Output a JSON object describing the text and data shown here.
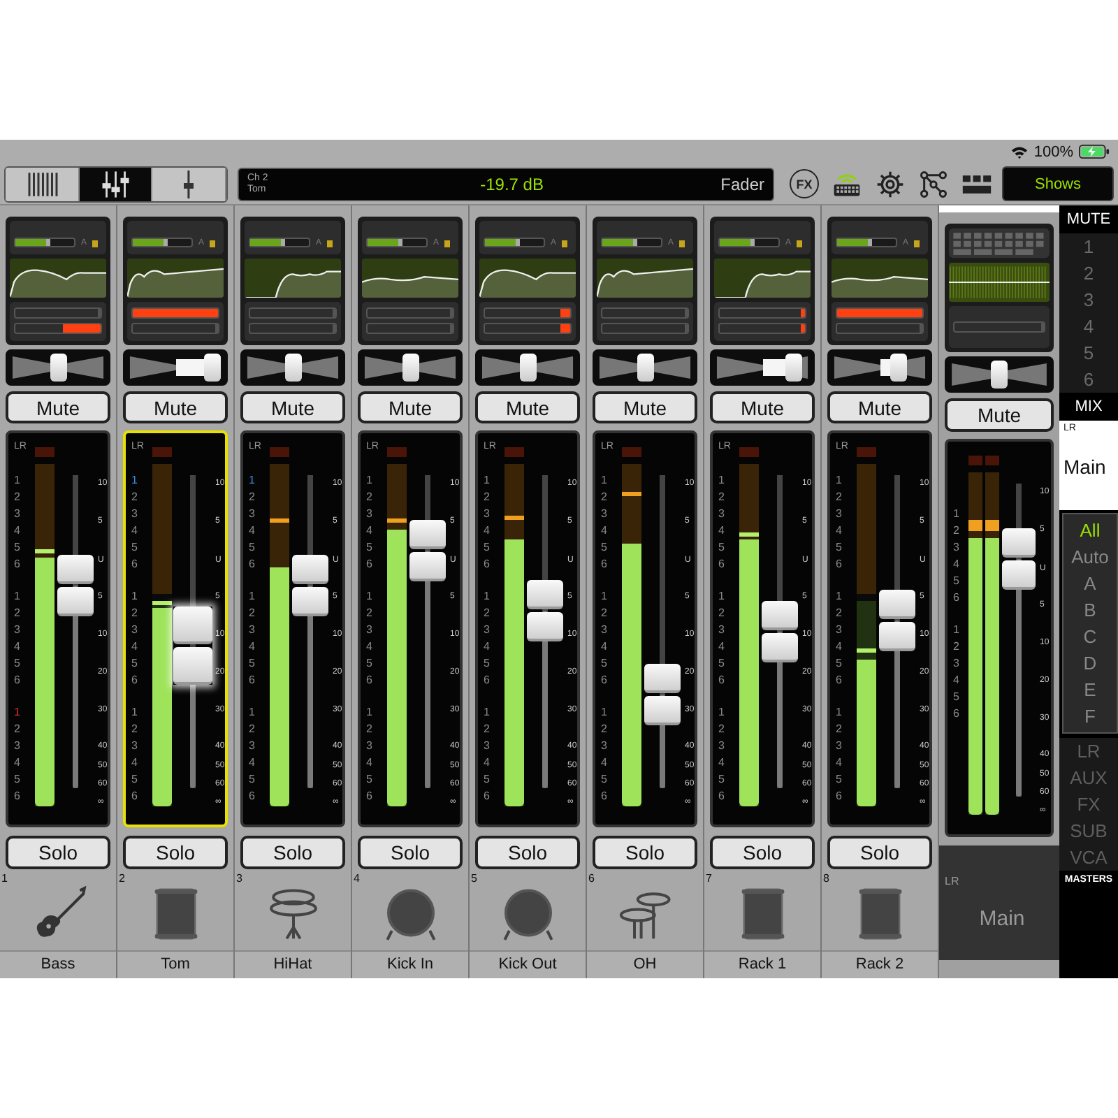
{
  "status_bar": {
    "battery": "100%"
  },
  "toolbar": {
    "views": [
      {
        "kind": "channels",
        "selected": false
      },
      {
        "kind": "faders",
        "selected": true
      },
      {
        "kind": "single",
        "selected": false
      }
    ],
    "display": {
      "channel": "Ch 2",
      "name": "Tom",
      "value": "-19.7 dB",
      "mode": "Fader"
    },
    "tools": [
      {
        "kind": "fx",
        "label": "FX",
        "on": false
      },
      {
        "kind": "keyboard",
        "on": true
      },
      {
        "kind": "gear",
        "on": false
      },
      {
        "kind": "routing",
        "on": false
      },
      {
        "kind": "grid",
        "on": false
      }
    ],
    "shows_button": "Shows"
  },
  "channels": [
    {
      "number": "1",
      "name": "Bass",
      "kind": "guitar",
      "selected": false,
      "gain": {
        "level": 0.6
      },
      "gain_label": "A",
      "dynamics": [
        {
          "level": 0
        },
        {
          "level": 0.45
        }
      ],
      "pan": {
        "level": 0.5
      },
      "mute": "Mute",
      "bus_label": "LR",
      "buses": [
        {
          "label": "1",
          "color": "#8a8a8a"
        },
        {
          "label": "2",
          "color": "#8a8a8a"
        },
        {
          "label": "3",
          "color": "#8a8a8a"
        },
        {
          "label": "4",
          "color": "#8a8a8a"
        },
        {
          "label": "5",
          "color": "#8a8a8a"
        },
        {
          "label": "6",
          "color": "#8a8a8a"
        },
        {
          "label": "1",
          "color": "#8a8a8a"
        },
        {
          "label": "2",
          "color": "#8a8a8a"
        },
        {
          "label": "3",
          "color": "#8a8a8a"
        },
        {
          "label": "4",
          "color": "#8a8a8a"
        },
        {
          "label": "5",
          "color": "#8a8a8a"
        },
        {
          "label": "6",
          "color": "#8a8a8a"
        },
        {
          "label": "1",
          "color": "#e0302a"
        },
        {
          "label": "2",
          "color": "#8a8a8a"
        },
        {
          "label": "3",
          "color": "#8a8a8a"
        },
        {
          "label": "4",
          "color": "#8a8a8a"
        },
        {
          "label": "5",
          "color": "#8a8a8a"
        },
        {
          "label": "6",
          "color": "#8a8a8a"
        }
      ],
      "meter": {
        "level": 0.73
      },
      "peak": {
        "level": 0.74,
        "color": "#b4f06a"
      },
      "fader": {
        "level": 0.65
      },
      "scale": [
        "10",
        "5",
        "U",
        "5",
        "10",
        "20",
        "30",
        "40",
        "50",
        "60",
        "∞"
      ],
      "solo": "Solo"
    },
    {
      "number": "2",
      "name": "Tom",
      "kind": "drum",
      "selected": true,
      "gain": {
        "level": 0.6
      },
      "gain_label": "A",
      "dynamics": [
        {
          "level": 1
        },
        {
          "level": 0
        }
      ],
      "pan": {
        "level": 0.85
      },
      "mute": "Mute",
      "bus_label": "LR",
      "buses": [
        {
          "label": "1",
          "color": "#3b8de0"
        },
        {
          "label": "2",
          "color": "#8a8a8a"
        },
        {
          "label": "3",
          "color": "#8a8a8a"
        },
        {
          "label": "4",
          "color": "#8a8a8a"
        },
        {
          "label": "5",
          "color": "#8a8a8a"
        },
        {
          "label": "6",
          "color": "#8a8a8a"
        },
        {
          "label": "1",
          "color": "#8a8a8a"
        },
        {
          "label": "2",
          "color": "#8a8a8a"
        },
        {
          "label": "3",
          "color": "#8a8a8a"
        },
        {
          "label": "4",
          "color": "#8a8a8a"
        },
        {
          "label": "5",
          "color": "#8a8a8a"
        },
        {
          "label": "6",
          "color": "#8a8a8a"
        },
        {
          "label": "1",
          "color": "#8a8a8a"
        },
        {
          "label": "2",
          "color": "#8a8a8a"
        },
        {
          "label": "3",
          "color": "#8a8a8a"
        },
        {
          "label": "4",
          "color": "#8a8a8a"
        },
        {
          "label": "5",
          "color": "#8a8a8a"
        },
        {
          "label": "6",
          "color": "#8a8a8a"
        }
      ],
      "meter": {
        "level": 0.58
      },
      "peak": {
        "level": 0.59,
        "color": "#b4f06a"
      },
      "fader": {
        "level": 0.43
      },
      "scale": [
        "10",
        "5",
        "U",
        "5",
        "10",
        "20",
        "30",
        "40",
        "50",
        "60",
        "∞"
      ],
      "solo": "Solo"
    },
    {
      "number": "3",
      "name": "HiHat",
      "kind": "hihat",
      "selected": false,
      "gain": {
        "level": 0.6
      },
      "gain_label": "A",
      "dynamics": [
        {
          "level": 0
        },
        {
          "level": 0
        }
      ],
      "pan": {
        "level": 0.5
      },
      "mute": "Mute",
      "bus_label": "LR",
      "buses": [
        {
          "label": "1",
          "color": "#3b8de0"
        },
        {
          "label": "2",
          "color": "#8a8a8a"
        },
        {
          "label": "3",
          "color": "#8a8a8a"
        },
        {
          "label": "4",
          "color": "#8a8a8a"
        },
        {
          "label": "5",
          "color": "#8a8a8a"
        },
        {
          "label": "6",
          "color": "#8a8a8a"
        },
        {
          "label": "1",
          "color": "#8a8a8a"
        },
        {
          "label": "2",
          "color": "#8a8a8a"
        },
        {
          "label": "3",
          "color": "#8a8a8a"
        },
        {
          "label": "4",
          "color": "#8a8a8a"
        },
        {
          "label": "5",
          "color": "#8a8a8a"
        },
        {
          "label": "6",
          "color": "#8a8a8a"
        },
        {
          "label": "1",
          "color": "#8a8a8a"
        },
        {
          "label": "2",
          "color": "#8a8a8a"
        },
        {
          "label": "3",
          "color": "#8a8a8a"
        },
        {
          "label": "4",
          "color": "#8a8a8a"
        },
        {
          "label": "5",
          "color": "#8a8a8a"
        },
        {
          "label": "6",
          "color": "#8a8a8a"
        }
      ],
      "meter": {
        "level": 0.7
      },
      "peak": {
        "level": 0.83,
        "color": "#f0a020"
      },
      "fader": {
        "level": 0.65
      },
      "scale": [
        "10",
        "5",
        "U",
        "5",
        "10",
        "20",
        "30",
        "40",
        "50",
        "60",
        "∞"
      ],
      "solo": "Solo"
    },
    {
      "number": "4",
      "name": "Kick In",
      "kind": "kick",
      "selected": false,
      "gain": {
        "level": 0.6
      },
      "gain_label": "A",
      "dynamics": [
        {
          "level": 0
        },
        {
          "level": 0
        }
      ],
      "pan": {
        "level": 0.5
      },
      "mute": "Mute",
      "bus_label": "LR",
      "buses": [
        {
          "label": "1",
          "color": "#8a8a8a"
        },
        {
          "label": "2",
          "color": "#8a8a8a"
        },
        {
          "label": "3",
          "color": "#8a8a8a"
        },
        {
          "label": "4",
          "color": "#8a8a8a"
        },
        {
          "label": "5",
          "color": "#8a8a8a"
        },
        {
          "label": "6",
          "color": "#8a8a8a"
        },
        {
          "label": "1",
          "color": "#8a8a8a"
        },
        {
          "label": "2",
          "color": "#8a8a8a"
        },
        {
          "label": "3",
          "color": "#8a8a8a"
        },
        {
          "label": "4",
          "color": "#8a8a8a"
        },
        {
          "label": "5",
          "color": "#8a8a8a"
        },
        {
          "label": "6",
          "color": "#8a8a8a"
        },
        {
          "label": "1",
          "color": "#8a8a8a"
        },
        {
          "label": "2",
          "color": "#8a8a8a"
        },
        {
          "label": "3",
          "color": "#8a8a8a"
        },
        {
          "label": "4",
          "color": "#8a8a8a"
        },
        {
          "label": "5",
          "color": "#8a8a8a"
        },
        {
          "label": "6",
          "color": "#8a8a8a"
        }
      ],
      "meter": {
        "level": 0.81
      },
      "peak": {
        "level": 0.83,
        "color": "#f0a020"
      },
      "fader": {
        "level": 0.76
      },
      "scale": [
        "10",
        "5",
        "U",
        "5",
        "10",
        "20",
        "30",
        "40",
        "50",
        "60",
        "∞"
      ],
      "solo": "Solo"
    },
    {
      "number": "5",
      "name": "Kick Out",
      "kind": "kick",
      "selected": false,
      "gain": {
        "level": 0.6
      },
      "gain_label": "A",
      "dynamics": [
        {
          "level": 0.12
        },
        {
          "level": 0.12
        }
      ],
      "pan": {
        "level": 0.5
      },
      "mute": "Mute",
      "bus_label": "LR",
      "buses": [
        {
          "label": "1",
          "color": "#8a8a8a"
        },
        {
          "label": "2",
          "color": "#8a8a8a"
        },
        {
          "label": "3",
          "color": "#8a8a8a"
        },
        {
          "label": "4",
          "color": "#8a8a8a"
        },
        {
          "label": "5",
          "color": "#8a8a8a"
        },
        {
          "label": "6",
          "color": "#8a8a8a"
        },
        {
          "label": "1",
          "color": "#8a8a8a"
        },
        {
          "label": "2",
          "color": "#8a8a8a"
        },
        {
          "label": "3",
          "color": "#8a8a8a"
        },
        {
          "label": "4",
          "color": "#8a8a8a"
        },
        {
          "label": "5",
          "color": "#8a8a8a"
        },
        {
          "label": "6",
          "color": "#8a8a8a"
        },
        {
          "label": "1",
          "color": "#8a8a8a"
        },
        {
          "label": "2",
          "color": "#8a8a8a"
        },
        {
          "label": "3",
          "color": "#8a8a8a"
        },
        {
          "label": "4",
          "color": "#8a8a8a"
        },
        {
          "label": "5",
          "color": "#8a8a8a"
        },
        {
          "label": "6",
          "color": "#8a8a8a"
        }
      ],
      "meter": {
        "level": 0.78
      },
      "peak": {
        "level": 0.84,
        "color": "#f0a020"
      },
      "fader": {
        "level": 0.57
      },
      "scale": [
        "10",
        "5",
        "U",
        "5",
        "10",
        "20",
        "30",
        "40",
        "50",
        "60",
        "∞"
      ],
      "solo": "Solo"
    },
    {
      "number": "6",
      "name": "OH",
      "kind": "cymbals",
      "selected": false,
      "gain": {
        "level": 0.6
      },
      "gain_label": "A",
      "dynamics": [
        {
          "level": 0
        },
        {
          "level": 0
        }
      ],
      "pan": {
        "level": 0.5
      },
      "mute": "Mute",
      "bus_label": "LR",
      "buses": [
        {
          "label": "1",
          "color": "#8a8a8a"
        },
        {
          "label": "2",
          "color": "#8a8a8a"
        },
        {
          "label": "3",
          "color": "#8a8a8a"
        },
        {
          "label": "4",
          "color": "#8a8a8a"
        },
        {
          "label": "5",
          "color": "#8a8a8a"
        },
        {
          "label": "6",
          "color": "#8a8a8a"
        },
        {
          "label": "1",
          "color": "#8a8a8a"
        },
        {
          "label": "2",
          "color": "#8a8a8a"
        },
        {
          "label": "3",
          "color": "#8a8a8a"
        },
        {
          "label": "4",
          "color": "#8a8a8a"
        },
        {
          "label": "5",
          "color": "#8a8a8a"
        },
        {
          "label": "6",
          "color": "#8a8a8a"
        },
        {
          "label": "1",
          "color": "#8a8a8a"
        },
        {
          "label": "2",
          "color": "#8a8a8a"
        },
        {
          "label": "3",
          "color": "#8a8a8a"
        },
        {
          "label": "4",
          "color": "#8a8a8a"
        },
        {
          "label": "5",
          "color": "#8a8a8a"
        },
        {
          "label": "6",
          "color": "#8a8a8a"
        }
      ],
      "meter": {
        "level": 0.77
      },
      "peak": {
        "level": 0.91,
        "color": "#f0a020"
      },
      "fader": {
        "level": 0.3
      },
      "scale": [
        "10",
        "5",
        "U",
        "5",
        "10",
        "20",
        "30",
        "40",
        "50",
        "60",
        "∞"
      ],
      "solo": "Solo"
    },
    {
      "number": "7",
      "name": "Rack 1",
      "kind": "drum",
      "selected": false,
      "gain": {
        "level": 0.6
      },
      "gain_label": "A",
      "dynamics": [
        {
          "level": 0.05
        },
        {
          "level": 0.05
        }
      ],
      "pan": {
        "level": 0.8
      },
      "mute": "Mute",
      "bus_label": "LR",
      "buses": [
        {
          "label": "1",
          "color": "#8a8a8a"
        },
        {
          "label": "2",
          "color": "#8a8a8a"
        },
        {
          "label": "3",
          "color": "#8a8a8a"
        },
        {
          "label": "4",
          "color": "#8a8a8a"
        },
        {
          "label": "5",
          "color": "#8a8a8a"
        },
        {
          "label": "6",
          "color": "#8a8a8a"
        },
        {
          "label": "1",
          "color": "#8a8a8a"
        },
        {
          "label": "2",
          "color": "#8a8a8a"
        },
        {
          "label": "3",
          "color": "#8a8a8a"
        },
        {
          "label": "4",
          "color": "#8a8a8a"
        },
        {
          "label": "5",
          "color": "#8a8a8a"
        },
        {
          "label": "6",
          "color": "#8a8a8a"
        },
        {
          "label": "1",
          "color": "#8a8a8a"
        },
        {
          "label": "2",
          "color": "#8a8a8a"
        },
        {
          "label": "3",
          "color": "#8a8a8a"
        },
        {
          "label": "4",
          "color": "#8a8a8a"
        },
        {
          "label": "5",
          "color": "#8a8a8a"
        },
        {
          "label": "6",
          "color": "#8a8a8a"
        }
      ],
      "meter": {
        "level": 0.78
      },
      "peak": {
        "level": 0.79,
        "color": "#b4f06a"
      },
      "fader": {
        "level": 0.5
      },
      "scale": [
        "10",
        "5",
        "U",
        "5",
        "10",
        "20",
        "30",
        "40",
        "50",
        "60",
        "∞"
      ],
      "solo": "Solo"
    },
    {
      "number": "8",
      "name": "Rack 2",
      "kind": "drum",
      "selected": false,
      "gain": {
        "level": 0.6
      },
      "gain_label": "A",
      "dynamics": [
        {
          "level": 1
        },
        {
          "level": 0
        }
      ],
      "pan": {
        "level": 0.68
      },
      "mute": "Mute",
      "bus_label": "LR",
      "buses": [
        {
          "label": "1",
          "color": "#8a8a8a"
        },
        {
          "label": "2",
          "color": "#8a8a8a"
        },
        {
          "label": "3",
          "color": "#8a8a8a"
        },
        {
          "label": "4",
          "color": "#8a8a8a"
        },
        {
          "label": "5",
          "color": "#8a8a8a"
        },
        {
          "label": "6",
          "color": "#8a8a8a"
        },
        {
          "label": "1",
          "color": "#8a8a8a"
        },
        {
          "label": "2",
          "color": "#8a8a8a"
        },
        {
          "label": "3",
          "color": "#8a8a8a"
        },
        {
          "label": "4",
          "color": "#8a8a8a"
        },
        {
          "label": "5",
          "color": "#8a8a8a"
        },
        {
          "label": "6",
          "color": "#8a8a8a"
        },
        {
          "label": "1",
          "color": "#8a8a8a"
        },
        {
          "label": "2",
          "color": "#8a8a8a"
        },
        {
          "label": "3",
          "color": "#8a8a8a"
        },
        {
          "label": "4",
          "color": "#8a8a8a"
        },
        {
          "label": "5",
          "color": "#8a8a8a"
        },
        {
          "label": "6",
          "color": "#8a8a8a"
        }
      ],
      "meter": {
        "level": 0.43
      },
      "peak": {
        "level": 0.45,
        "color": "#b4f06a"
      },
      "fader": {
        "level": 0.54
      },
      "scale": [
        "10",
        "5",
        "U",
        "5",
        "10",
        "20",
        "30",
        "40",
        "50",
        "60",
        "∞"
      ],
      "solo": "Solo"
    }
  ],
  "master": {
    "dynamics": [
      {
        "level": 0
      }
    ],
    "pan": {
      "level": 0.5
    },
    "mute": "Mute",
    "buses": [
      {
        "label": "1"
      },
      {
        "label": "2"
      },
      {
        "label": "3"
      },
      {
        "label": "4"
      },
      {
        "label": "5"
      },
      {
        "label": "6"
      },
      {
        "label": "1"
      },
      {
        "label": "2"
      },
      {
        "label": "3"
      },
      {
        "label": "4"
      },
      {
        "label": "5"
      },
      {
        "label": "6"
      }
    ],
    "meters": [
      {
        "level": 0.81,
        "peak": {
          "level": 0.83
        }
      },
      {
        "level": 0.81,
        "peak": {
          "level": 0.83
        }
      }
    ],
    "fader": {
      "level": 0.76
    },
    "scale": [
      "10",
      "5",
      "U",
      "5",
      "10",
      "20",
      "30",
      "40",
      "50",
      "60",
      "∞"
    ],
    "bus": "LR",
    "name": "Main"
  },
  "sidebar": {
    "mute_title": "MUTE",
    "mute_groups": [
      {
        "label": "1",
        "on": false
      },
      {
        "label": "2",
        "on": false
      },
      {
        "label": "3",
        "on": false
      },
      {
        "label": "4",
        "on": false
      },
      {
        "label": "5",
        "on": false
      },
      {
        "label": "6",
        "on": false
      }
    ],
    "mix_title": "MIX",
    "mix_bus": "LR",
    "mix_name": "Main",
    "filters": [
      {
        "label": "All",
        "selected": true
      },
      {
        "label": "Auto",
        "selected": false
      },
      {
        "label": "A",
        "selected": false
      },
      {
        "label": "B",
        "selected": false
      },
      {
        "label": "C",
        "selected": false
      },
      {
        "label": "D",
        "selected": false
      },
      {
        "label": "E",
        "selected": false
      },
      {
        "label": "F",
        "selected": false
      }
    ],
    "masters": [
      {
        "label": "LR",
        "disabled": true
      },
      {
        "label": "AUX",
        "disabled": true
      },
      {
        "label": "FX",
        "disabled": true
      },
      {
        "label": "SUB",
        "disabled": true
      },
      {
        "label": "VCA",
        "disabled": true
      }
    ],
    "masters_title": "MASTERS"
  }
}
